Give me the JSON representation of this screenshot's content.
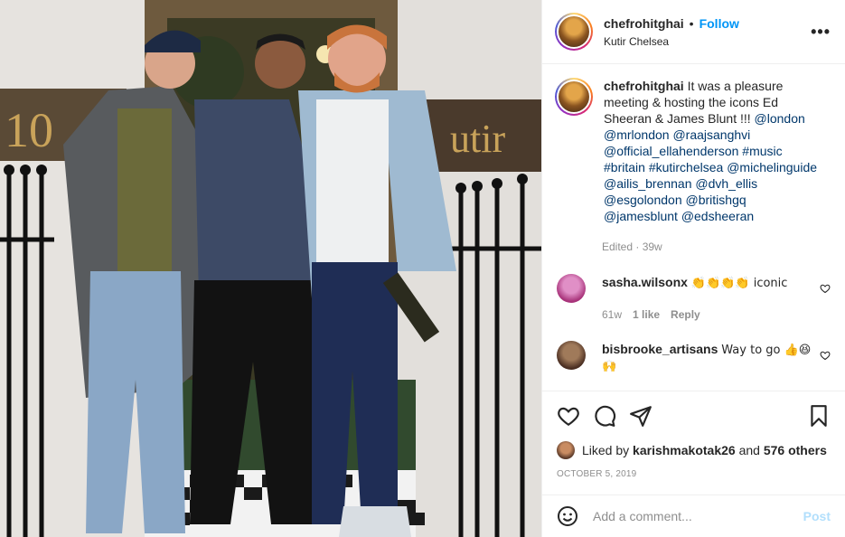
{
  "post": {
    "username": "chefrohitghai",
    "follow_label": "Follow",
    "location": "Kutir Chelsea",
    "dot": "•",
    "more_label": "•••",
    "photo_alt": "Four men standing in front of Kutir Chelsea restaurant door, sign reading 10 and Kutir",
    "sign_number": "10",
    "sign_name": "utir"
  },
  "caption": {
    "username": "chefrohitghai",
    "text": "It was a pleasure meeting & hosting the icons Ed Sheeran & James Blunt !!!",
    "tags": [
      "@london",
      "@mrlondon",
      "@raajsanghvi",
      "@official_ellahenderson",
      "#music",
      "#britain",
      "#kutirchelsea",
      "@michelinguide",
      "@ailis_brennan",
      "@dvh_ellis",
      "@esgolondon",
      "@britishgq",
      "@jamesblunt",
      "@edsheeran"
    ],
    "edited": "Edited · 39w"
  },
  "comments": [
    {
      "username": "sasha.wilsonx",
      "text": "👏👏👏👏 iconic",
      "time": "61w",
      "likes": "1 like",
      "reply": "Reply",
      "avatar_color": "#d65fb0"
    },
    {
      "username": "bisbrooke_artisans",
      "text": "Way to go 👍😆",
      "text2": "🙌",
      "avatar_color": "#6b4a3a"
    }
  ],
  "likes": {
    "prefix": "Liked by",
    "user": "karishmakotak26",
    "and": "and",
    "others": "576 others"
  },
  "date": "OCTOBER 5, 2019",
  "add_comment": {
    "placeholder": "Add a comment...",
    "post_label": "Post"
  },
  "colors": {
    "accent": "#0095f6",
    "link": "#00376b",
    "muted": "#8e8e8e"
  },
  "icons": [
    "heart-icon",
    "comment-icon",
    "share-icon",
    "bookmark-icon",
    "emoji-icon",
    "more-icon"
  ]
}
